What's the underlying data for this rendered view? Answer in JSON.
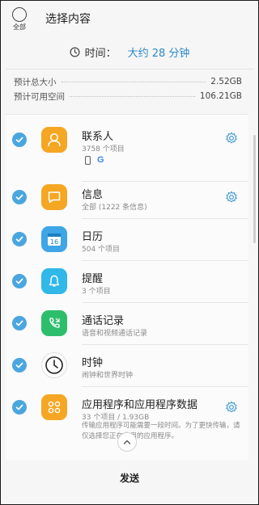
{
  "header": {
    "select_all_label": "全部",
    "title": "选择内容"
  },
  "time": {
    "icon": "clock-icon",
    "label": "时间：",
    "value": "大约 28 分钟",
    "value_color": "#2a89c9"
  },
  "sizes": {
    "total_label": "预计总大小",
    "total_value": "2.52GB",
    "available_label": "预计可用空间",
    "available_value": "106.21GB"
  },
  "items": [
    {
      "name": "联系人",
      "sub": "3758 个项目",
      "icon": "contacts-icon",
      "color": "#f5a623",
      "checked": true,
      "has_settings": true
    },
    {
      "name": "信息",
      "sub": "全部 (1222 条信息)",
      "icon": "messages-icon",
      "color": "#f5a623",
      "checked": true,
      "has_settings": true
    },
    {
      "name": "日历",
      "sub": "504 个项目",
      "icon": "calendar-icon",
      "color": "#3ea6e6",
      "checked": true,
      "has_settings": false
    },
    {
      "name": "提醒",
      "sub": "3 个项目",
      "icon": "reminder-icon",
      "color": "#2fb8e8",
      "checked": true,
      "has_settings": false
    },
    {
      "name": "通话记录",
      "sub": "语音和视频通话记录",
      "icon": "call-log-icon",
      "color": "#2dbe6c",
      "checked": true,
      "has_settings": false
    },
    {
      "name": "时钟",
      "sub": "闹钟和世界时钟",
      "icon": "clock-app-icon",
      "color": "#ffffff",
      "checked": true,
      "has_settings": false
    },
    {
      "name": "应用程序和应用程序数据",
      "sub": "33 个项目 / 1.93GB",
      "desc": "传输应用程序可能需要一段时间。为了更快传输，请仅选择您正在使用的应用程序。",
      "icon": "apps-icon",
      "color": "#f5a623",
      "checked": true,
      "has_settings": true
    }
  ],
  "bottom": {
    "send_label": "发送"
  }
}
